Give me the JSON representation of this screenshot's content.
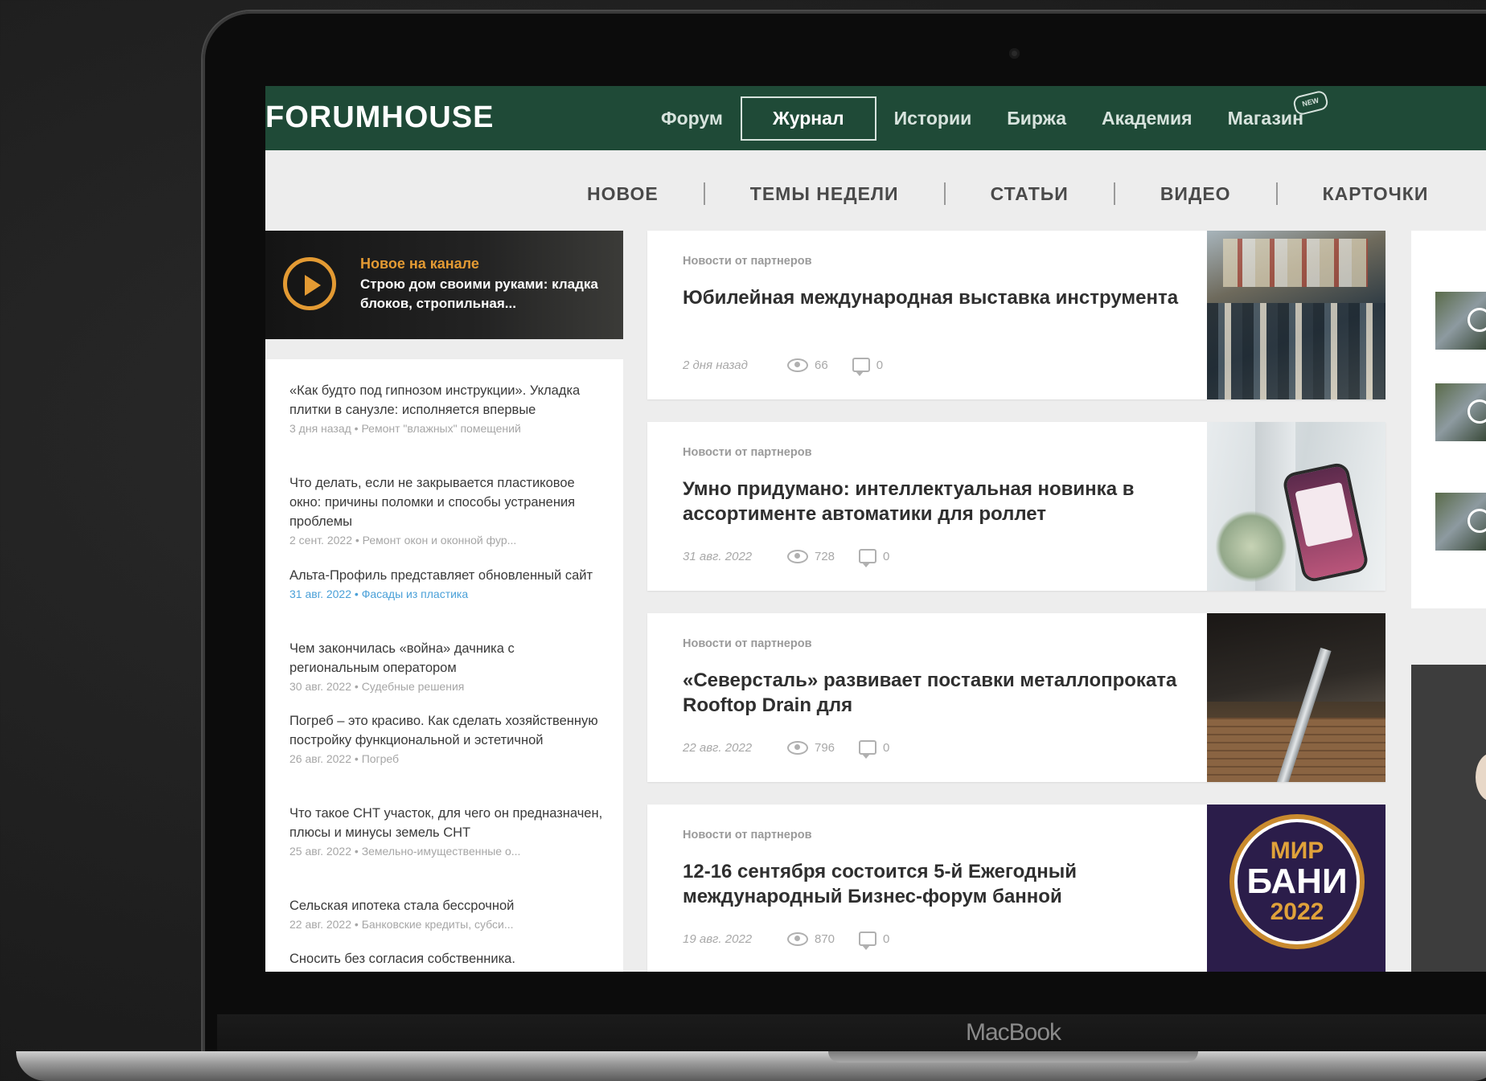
{
  "topbar": {
    "logo": "FORUMHOUSE",
    "nav": [
      "Форум",
      "Журнал",
      "Истории",
      "Биржа",
      "Академия",
      "Магазин"
    ],
    "active": "Журнал",
    "new_badge": "NEW",
    "color": "#1f4a37"
  },
  "subnav": [
    "НОВОЕ",
    "ТЕМЫ НЕДЕЛИ",
    "СТАТЬИ",
    "ВИДЕО",
    "КАРТОЧКИ"
  ],
  "promo": {
    "title": "Новое на канале",
    "text": "Строю дом своими руками: кладка блоков, стропильная..."
  },
  "news": [
    {
      "title": "«Как будто под гипнозом инструкции». Укладка плитки в санузле: исполняется впервые",
      "meta": "3 дня назад  •  Ремонт \"влажных\" помещений"
    },
    {
      "title": "Что делать, если не закрывается пластиковое окно: причины поломки и способы устранения проблемы",
      "meta": "2 сент. 2022  •  Ремонт окон и оконной фур..."
    },
    {
      "title": "Альта-Профиль представляет обновленный сайт",
      "meta": "31 авг. 2022  •  Фасады из пластика"
    },
    {
      "title": "Чем закончилась «война» дачника с региональным оператором",
      "meta": "30 авг. 2022  •  Судебные решения"
    },
    {
      "title": "Погреб – это красиво. Как сделать хозяйственную постройку функциональной и эстетичной",
      "meta": "26 авг. 2022  •  Погреб"
    },
    {
      "title": "Что такое СНТ участок, для чего он предназначен, плюсы и минусы земель СНТ",
      "meta": "25 авг. 2022  •  Земельно-имущественные о..."
    },
    {
      "title": "Сельская ипотека стала бессрочной",
      "meta": "22 авг. 2022  •  Банковские кредиты, субси..."
    },
    {
      "title": "Сносить без согласия собственника.",
      "meta": ""
    }
  ],
  "cards": [
    {
      "tag": "Новости от партнеров",
      "title": "Юбилейная международная выставка инструмента",
      "date": "2 дня назад",
      "views": "66",
      "comments": "0"
    },
    {
      "tag": "Новости от партнеров",
      "title": "Умно придумано: интеллектуальная новинка в ассортименте автоматики для роллет",
      "date": "31 авг. 2022",
      "views": "728",
      "comments": "0"
    },
    {
      "tag": "Новости от партнеров",
      "title": "«Северсталь» развивает поставки металлопроката Rooftop Drain для",
      "date": "22 авг. 2022",
      "views": "796",
      "comments": "0"
    },
    {
      "tag": "Новости от партнеров",
      "title": "12-16 сентября состоится 5-й Ежегодный международный Бизнес-форум банной",
      "date": "19 авг. 2022",
      "views": "870",
      "comments": "0"
    }
  ],
  "badge": {
    "line1": "МИР",
    "line2": "БАНИ",
    "line3": "2022"
  },
  "laptop_label": "MacBook"
}
